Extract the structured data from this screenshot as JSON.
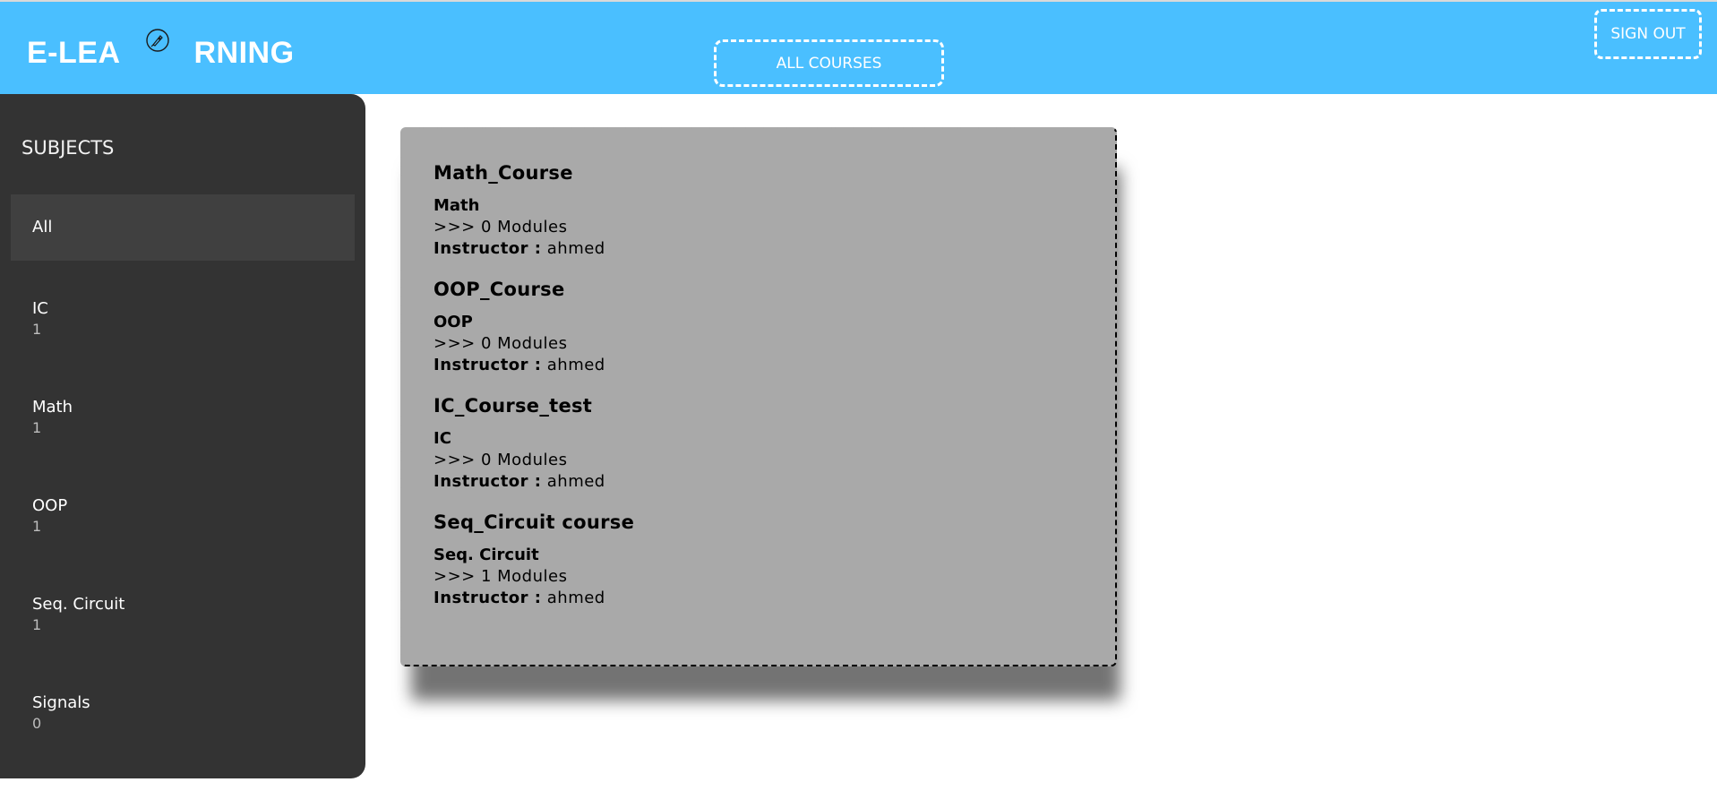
{
  "header": {
    "logo_left": "E-LEA",
    "logo_right": "RNING",
    "logo_icon": "rocket-badge-icon",
    "nav_all_courses": "ALL COURSES",
    "sign_out": "SIGN OUT",
    "bg_color": "#4abfff"
  },
  "sidebar": {
    "title": "SUBJECTS",
    "items": [
      {
        "label": "All",
        "count": ""
      },
      {
        "label": "IC",
        "count": "1"
      },
      {
        "label": "Math",
        "count": "1"
      },
      {
        "label": "OOP",
        "count": "1"
      },
      {
        "label": "Seq. Circuit",
        "count": "1"
      },
      {
        "label": "Signals",
        "count": "0"
      }
    ],
    "bg_color": "#333333"
  },
  "courses": [
    {
      "title": "Math_Course",
      "subject": "Math",
      "modules": ">>> 0 Modules",
      "instructor_label": "Instructor :",
      "instructor": "ahmed"
    },
    {
      "title": "OOP_Course",
      "subject": "OOP",
      "modules": ">>> 0 Modules",
      "instructor_label": "Instructor :",
      "instructor": "ahmed"
    },
    {
      "title": "IC_Course_test",
      "subject": "IC",
      "modules": ">>> 0 Modules",
      "instructor_label": "Instructor :",
      "instructor": "ahmed"
    },
    {
      "title": "Seq_Circuit course",
      "subject": "Seq. Circuit",
      "modules": ">>> 1 Modules",
      "instructor_label": "Instructor :",
      "instructor": "ahmed"
    }
  ]
}
